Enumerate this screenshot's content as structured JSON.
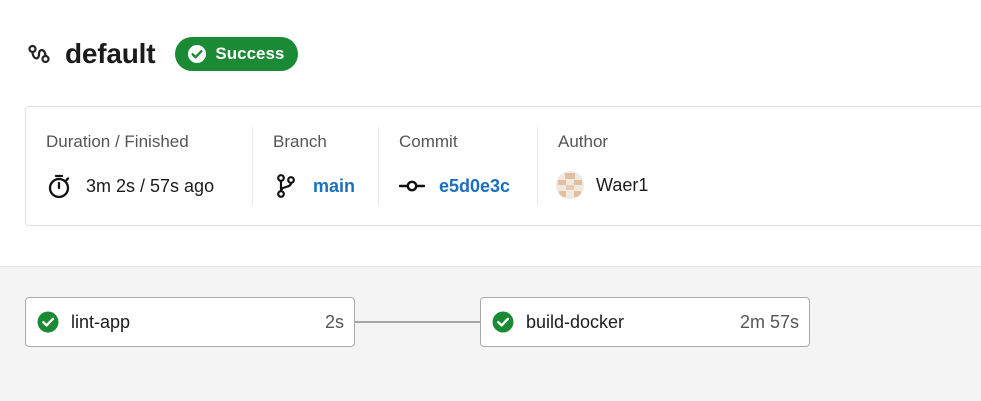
{
  "header": {
    "title": "default",
    "status_label": "Success",
    "icon": "workflow-icon"
  },
  "info": {
    "duration": {
      "label": "Duration / Finished",
      "value": "3m 2s / 57s ago",
      "icon": "stopwatch-icon"
    },
    "branch": {
      "label": "Branch",
      "value": "main",
      "icon": "git-branch-icon"
    },
    "commit": {
      "label": "Commit",
      "value": "e5d0e3c",
      "icon": "git-commit-icon"
    },
    "author": {
      "label": "Author",
      "value": "Waer1",
      "icon": "avatar"
    }
  },
  "jobs": [
    {
      "name": "lint-app",
      "duration": "2s",
      "status": "success"
    },
    {
      "name": "build-docker",
      "duration": "2m 57s",
      "status": "success"
    }
  ],
  "colors": {
    "success": "#1a8a35",
    "link": "#1a6fbf",
    "graph_background": "#f4f4f4"
  }
}
